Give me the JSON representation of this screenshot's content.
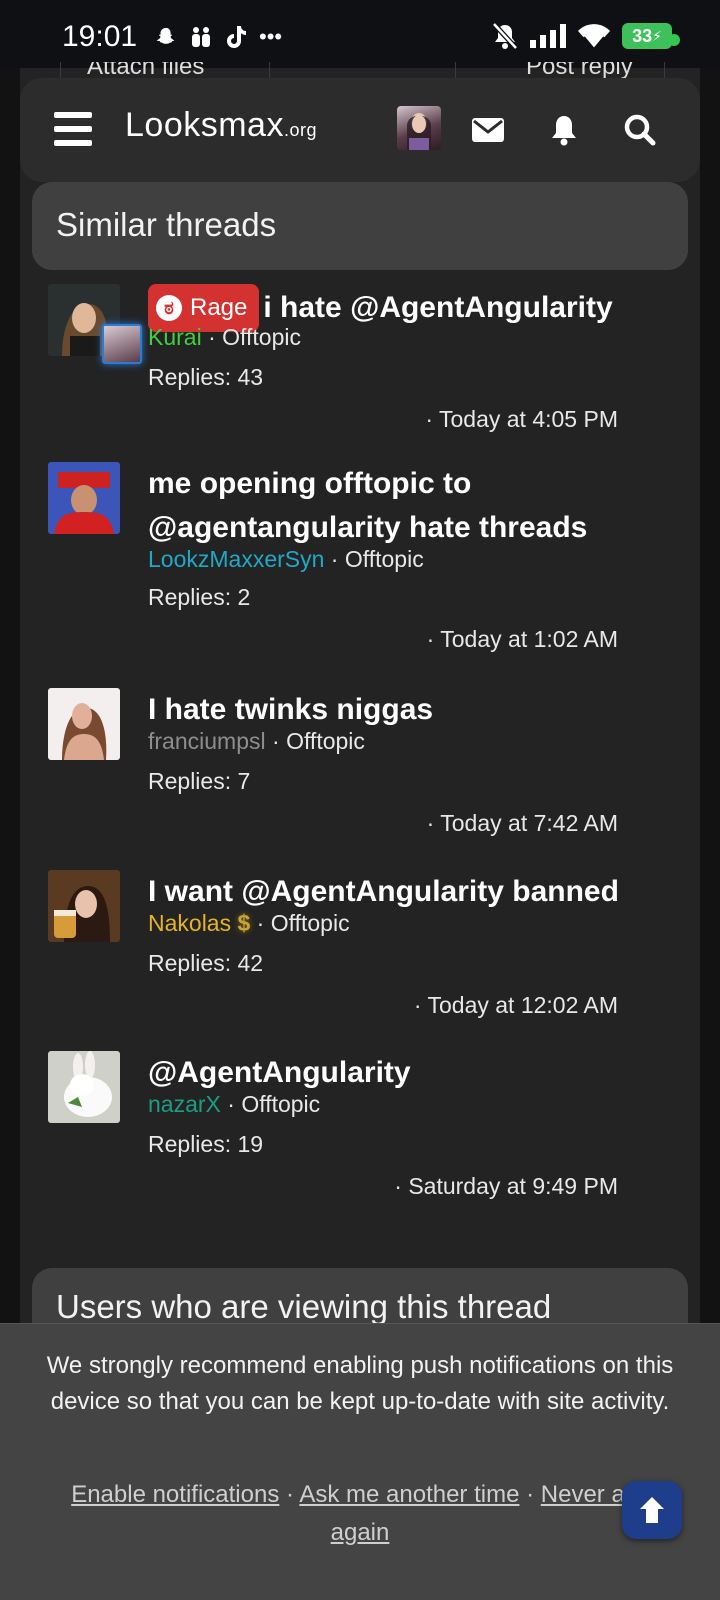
{
  "status_bar": {
    "time": "19:01",
    "battery": "33"
  },
  "background_peek": {
    "left_button": "Attach files",
    "right_button": "Post reply"
  },
  "header": {
    "logo_main": "Looksmax",
    "logo_suffix": ".org"
  },
  "similar_threads": {
    "title": "Similar threads",
    "items": [
      {
        "prefix": "Rage",
        "title": "i hate @AgentAngularity",
        "author": "Kurai",
        "author_color": "#3fd13a",
        "forum": "Offtopic",
        "replies": "Replies: 43",
        "date": "Today at 4:05 PM"
      },
      {
        "prefix": "",
        "title": "me opening offtopic to @agentangularity hate threads",
        "author": "LookzMaxxerSyn",
        "author_color": "#1fa9c9",
        "forum": "Offtopic",
        "replies": "Replies: 2",
        "date": "Today at 1:02 AM"
      },
      {
        "prefix": "",
        "title": "I hate twinks niggas",
        "author": "franciumpsl",
        "author_color": "#8e8e8e",
        "forum": "Offtopic",
        "replies": "Replies: 7",
        "date": "Today at 7:42 AM"
      },
      {
        "prefix": "",
        "title": "I want @AgentAngularity banned",
        "author": "Nakolas",
        "author_color": "#e6b422",
        "forum": "Offtopic",
        "replies": "Replies: 42",
        "date": "Today at 12:02 AM"
      },
      {
        "prefix": "",
        "title": "@AgentAngularity",
        "author": "nazarX",
        "author_color": "#1a9e86",
        "forum": "Offtopic",
        "replies": "Replies: 19",
        "date": "Saturday at 9:49 PM"
      }
    ]
  },
  "users_viewing": {
    "title": "Users who are viewing this thread"
  },
  "push_notice": {
    "text": "We strongly recommend enabling push notifications on this device so that you can be kept up-to-date with site activity.",
    "enable": "Enable notifications",
    "later": "Ask me another time",
    "never": "Never ask again",
    "separator": " · "
  }
}
